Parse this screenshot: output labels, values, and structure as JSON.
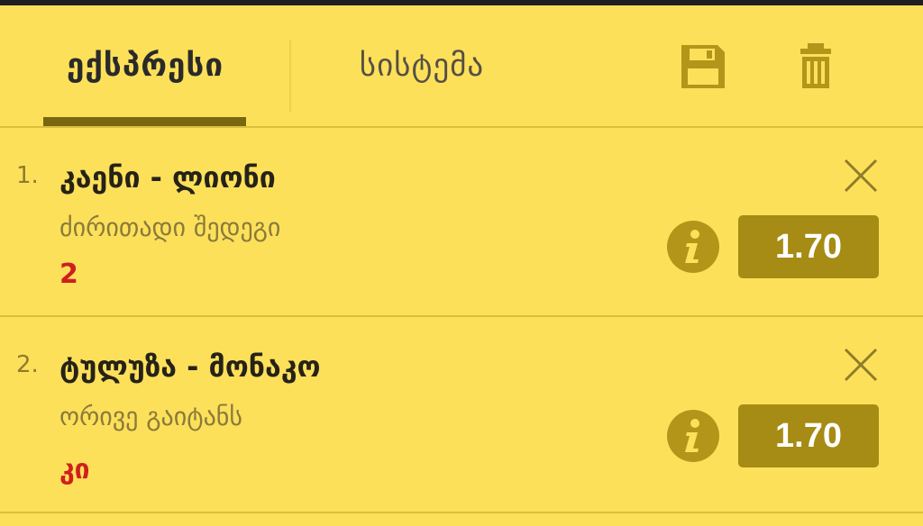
{
  "tabs": {
    "express_label": "ექსპრესი",
    "system_label": "სისტემა"
  },
  "toolbar": {
    "save_icon": "save-icon",
    "trash_icon": "trash-icon"
  },
  "bets": [
    {
      "index": "1.",
      "match": "კაენი - ლიონი",
      "market": "ძირითადი შედეგი",
      "selection": "2",
      "odds": "1.70"
    },
    {
      "index": "2.",
      "match": "ტულუზა - მონაკო",
      "market": "ორივე გაიტანს",
      "selection": "კი",
      "odds": "1.70"
    }
  ],
  "colors": {
    "background": "#fde05a",
    "accent": "#a68b14",
    "selection": "#d01e1e",
    "tab_indicator": "#7a6510"
  }
}
